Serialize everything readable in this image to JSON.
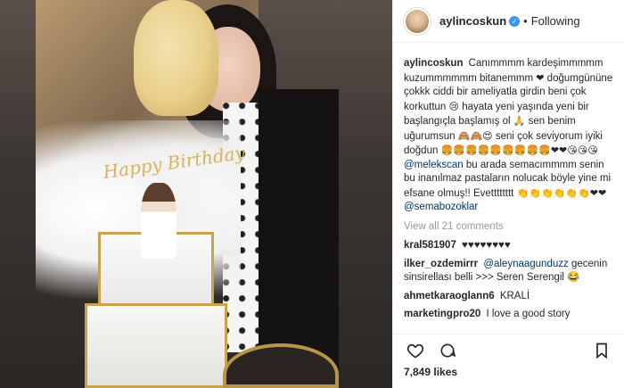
{
  "post": {
    "username": "aylincoskun",
    "follow_state": "Following",
    "separator": "•",
    "verified_mark": "✓",
    "photo_topper_text": "Happy Birthday"
  },
  "caption": {
    "username": "aylincoskun",
    "part1": "Canımmmm kardeşimmmmm kuzummmmmm bitanemmm",
    "emoji1": "❤",
    "part2": "doğumgününe çokkk ciddi bir ameliyatla girdin beni çok korkuttun",
    "emoji2": "😢",
    "part3": "hayata yeni yaşında yeni bir başlangıçla başlamış ol",
    "emoji3": "🙏",
    "part4": "sen benim uğurumsun",
    "emoji4": "🙈🙈😍",
    "part5": "seni çok seviyorum iyiki doğdun",
    "emoji5": "🍔🍔🍔🍔🍔🍔🍔🍔🍔❤❤😘😘😘",
    "mention1": "@melekscan",
    "part6": "bu arada semacımmmm senin bu inanılmaz pastaların nolucak böyle yine mi efsane olmuş!! Evetttttttt",
    "emoji6": "👏👏👏👏👏👏❤❤",
    "mention2": "@semabozoklar"
  },
  "view_all_label": "View all 21 comments",
  "comments": [
    {
      "user": "kral581907",
      "text": "♥♥♥♥♥♥♥♥",
      "mention": ""
    },
    {
      "user": "ilker_ozdemirrr",
      "mention": "@aleynaagunduzz",
      "text": "gecenin sinsirellası belli >>> Seren Serengil 😂"
    },
    {
      "user": "ahmetkaraoglann6",
      "text": "KRALİ",
      "mention": ""
    },
    {
      "user": "marketingpro20",
      "text": "I love a good story",
      "mention": ""
    }
  ],
  "likes": "7,849 likes",
  "icons": [
    "heart-icon",
    "comment-icon",
    "bookmark-icon"
  ],
  "colors": {
    "verified": "#3897f0",
    "mention": "#003569",
    "muted": "#999999"
  }
}
